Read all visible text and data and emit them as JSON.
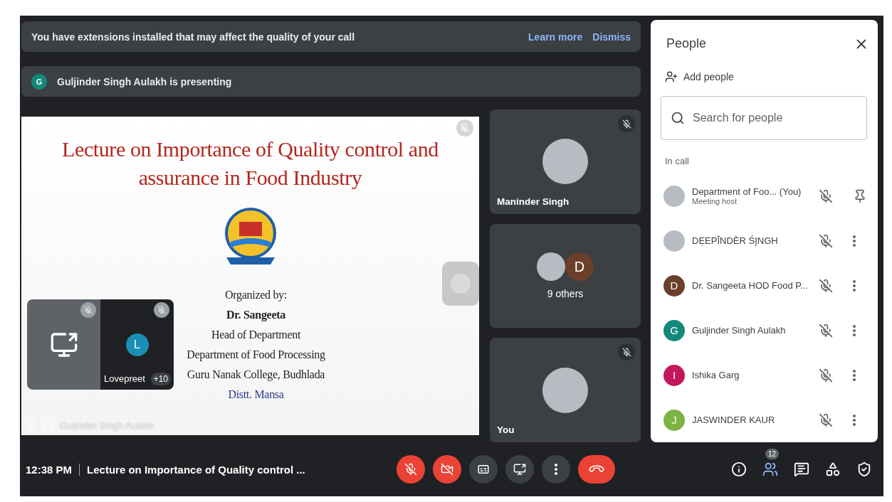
{
  "notice": {
    "text": "You have extensions installed that may affect the quality of your call",
    "actions": [
      "Learn more",
      "Dismiss"
    ]
  },
  "presenting": {
    "initial": "G",
    "color": "#12897a",
    "text": "Guljinder Singh Aulakh is presenting"
  },
  "slide": {
    "title": "Lecture on Importance of Quality control and assurance in Food Industry",
    "muted": true,
    "lines": [
      {
        "text": "Organized by:",
        "kind": "plain"
      },
      {
        "text": "Dr. Sangeeta",
        "kind": "bold"
      },
      {
        "text": "Head of Department",
        "kind": "plain"
      },
      {
        "text": "Department of Food Processing",
        "kind": "plain"
      },
      {
        "text": "Guru Nanak College, Budhlada",
        "kind": "plain"
      },
      {
        "text": "Distt. Mansa",
        "kind": "accent"
      }
    ],
    "presenter_label": "Guljinder Singh Aulakh"
  },
  "self_view": {
    "name": "Lovepreet",
    "initial": "L",
    "color": "#1a8fb5",
    "more": "+10",
    "muted": true
  },
  "tiles": [
    {
      "kind": "photo",
      "name": "Maninder Singh",
      "muted": true
    },
    {
      "kind": "group",
      "initial": "D",
      "color": "#6b3f2a",
      "label": "9 others",
      "muted": false
    },
    {
      "kind": "photo",
      "name": "You",
      "muted": true
    }
  ],
  "people": {
    "title": "People",
    "add": "Add people",
    "search_placeholder": "Search for people",
    "section": "In call",
    "members": [
      {
        "name": "Department of Foo...",
        "suffix": "(You)",
        "role": "Meeting host",
        "avatar": {
          "kind": "photo"
        },
        "action": {
          "kind": "pin"
        },
        "muted": true
      },
      {
        "name": "DẸEPÎNDÈR ŚĮNGH",
        "avatar": {
          "kind": "photo"
        },
        "action": {
          "kind": "more"
        },
        "muted": true
      },
      {
        "name": "Dr. Sangeeta HOD Food P...",
        "avatar": {
          "kind": "initial",
          "initial": "D",
          "color": "#6b3f2a"
        },
        "action": {
          "kind": "more"
        },
        "muted": true
      },
      {
        "name": "Guljinder Singh Aulakh",
        "avatar": {
          "kind": "initial",
          "initial": "G",
          "color": "#12897a"
        },
        "action": {
          "kind": "more"
        },
        "muted": true
      },
      {
        "name": "Ishika Garg",
        "avatar": {
          "kind": "initial",
          "initial": "I",
          "color": "#c2185b"
        },
        "action": {
          "kind": "more"
        },
        "muted": true
      },
      {
        "name": "JASWINDER KAUR",
        "avatar": {
          "kind": "initial",
          "initial": "J",
          "color": "#7cb342"
        },
        "action": {
          "kind": "more"
        },
        "muted": true
      }
    ]
  },
  "bottom": {
    "time": "12:38 PM",
    "meeting_title": "Lecture on Importance of Quality control ...",
    "controls": [
      {
        "kind": "mic",
        "off": true
      },
      {
        "kind": "camera",
        "off": true
      },
      {
        "kind": "captions"
      },
      {
        "kind": "present"
      },
      {
        "kind": "more"
      },
      {
        "kind": "hangup"
      }
    ],
    "side": [
      {
        "kind": "info",
        "selected": false
      },
      {
        "kind": "people",
        "selected": true,
        "badge": "12"
      },
      {
        "kind": "chat",
        "selected": false
      },
      {
        "kind": "activities",
        "selected": false
      },
      {
        "kind": "safety",
        "selected": false
      }
    ]
  }
}
